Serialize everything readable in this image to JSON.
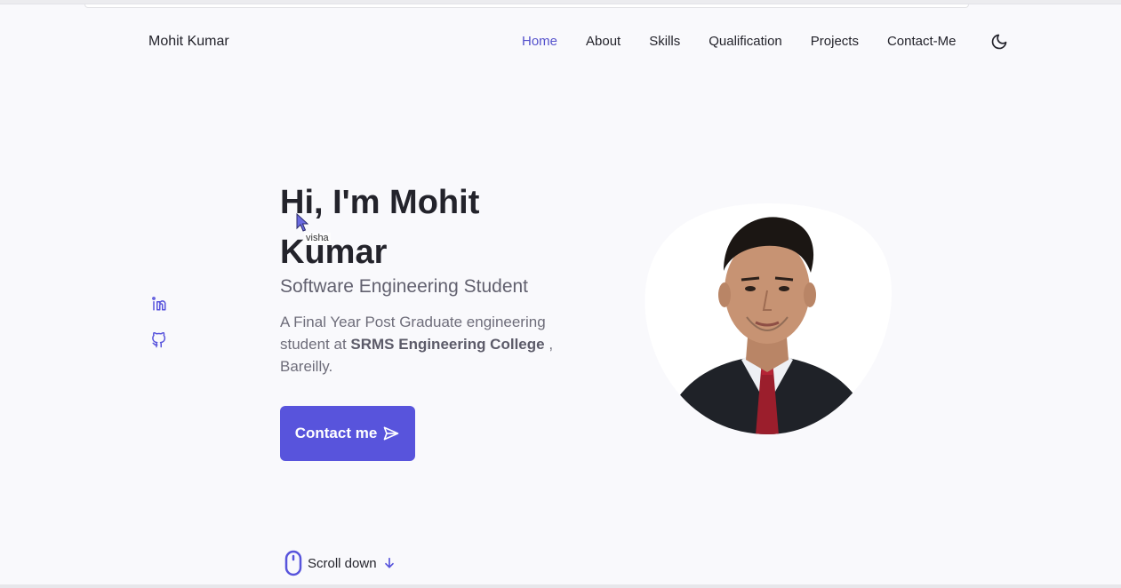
{
  "header": {
    "brand": "Mohit Kumar",
    "nav": [
      {
        "label": "Home",
        "active": true
      },
      {
        "label": "About",
        "active": false
      },
      {
        "label": "Skills",
        "active": false
      },
      {
        "label": "Qualification",
        "active": false
      },
      {
        "label": "Projects",
        "active": false
      },
      {
        "label": "Contact-Me",
        "active": false
      }
    ],
    "theme_icon": "moon-icon"
  },
  "social": [
    {
      "icon": "linkedin-icon"
    },
    {
      "icon": "github-icon"
    }
  ],
  "hero": {
    "title": "Hi, I'm Mohit Kumar",
    "subtitle": "Software Engineering Student",
    "description_prefix": "A Final Year Post Graduate engineering student at ",
    "college": "SRMS Engineering College",
    "description_suffix": " , Bareilly.",
    "button_label": "Contact me",
    "button_icon": "send-icon"
  },
  "profile_image": {
    "icon": "profile-photo"
  },
  "scroll": {
    "label": "Scroll down",
    "icon": "mouse-icon",
    "arrow_icon": "arrow-down-icon"
  },
  "tooltip": "visha",
  "colors": {
    "accent": "#5854dc",
    "background": "#f9f9fc",
    "text": "#23232b"
  }
}
